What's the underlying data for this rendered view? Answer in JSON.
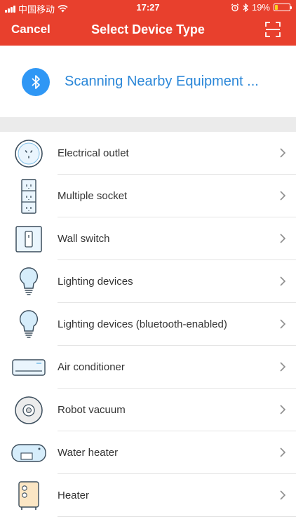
{
  "status_bar": {
    "carrier": "中国移动",
    "time": "17:27",
    "battery_percent": "19%",
    "battery_level": 0.19,
    "battery_color": "#f7d21e"
  },
  "nav": {
    "cancel_label": "Cancel",
    "title": "Select Device Type",
    "scan_icon": "scan-frame-icon"
  },
  "scan": {
    "text": "Scanning Nearby Equipment ...",
    "icon": "bluetooth-icon"
  },
  "colors": {
    "header_bg": "#e8402d",
    "accent_blue": "#2f97f5",
    "scan_text": "#2b87d8",
    "separator": "#ebebeb"
  },
  "devices": [
    {
      "label": "Electrical outlet",
      "icon": "outlet-icon"
    },
    {
      "label": "Multiple socket",
      "icon": "power-strip-icon"
    },
    {
      "label": "Wall switch",
      "icon": "wall-switch-icon"
    },
    {
      "label": "Lighting devices",
      "icon": "lightbulb-icon"
    },
    {
      "label": "Lighting devices (bluetooth-enabled)",
      "icon": "lightbulb-icon"
    },
    {
      "label": "Air conditioner",
      "icon": "air-conditioner-icon"
    },
    {
      "label": "Robot vacuum",
      "icon": "robot-vacuum-icon"
    },
    {
      "label": "Water heater",
      "icon": "water-heater-icon"
    },
    {
      "label": "Heater",
      "icon": "heater-icon"
    }
  ]
}
